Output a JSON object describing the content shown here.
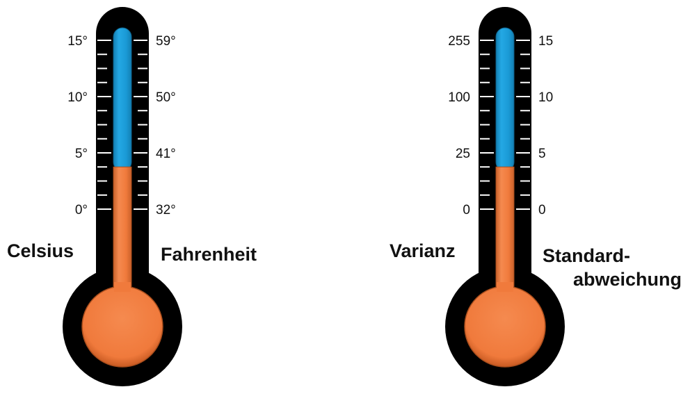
{
  "colors": {
    "body": "#000000",
    "upper_column": "#1a9ad6",
    "lower_column": "#f07a3c",
    "bulb": "#f07a3c",
    "ticks": "#ffffff"
  },
  "thermometers": [
    {
      "name": "celsius-fahrenheit",
      "fill_fraction": 0.25,
      "left_ticks": [
        "15°",
        "10°",
        "5°",
        "0°"
      ],
      "right_ticks": [
        "59°",
        "50°",
        "41°",
        "32°"
      ],
      "left_label": "Celsius",
      "right_label_line1": "Fahrenheit",
      "right_label_line2": ""
    },
    {
      "name": "varianz-standardabweichung",
      "fill_fraction": 0.25,
      "left_ticks": [
        "255",
        "100",
        "25",
        "0"
      ],
      "right_ticks": [
        "15",
        "10",
        "5",
        "0"
      ],
      "left_label": "Varianz",
      "right_label_line1": "Standard-",
      "right_label_line2": "abweichung"
    }
  ]
}
